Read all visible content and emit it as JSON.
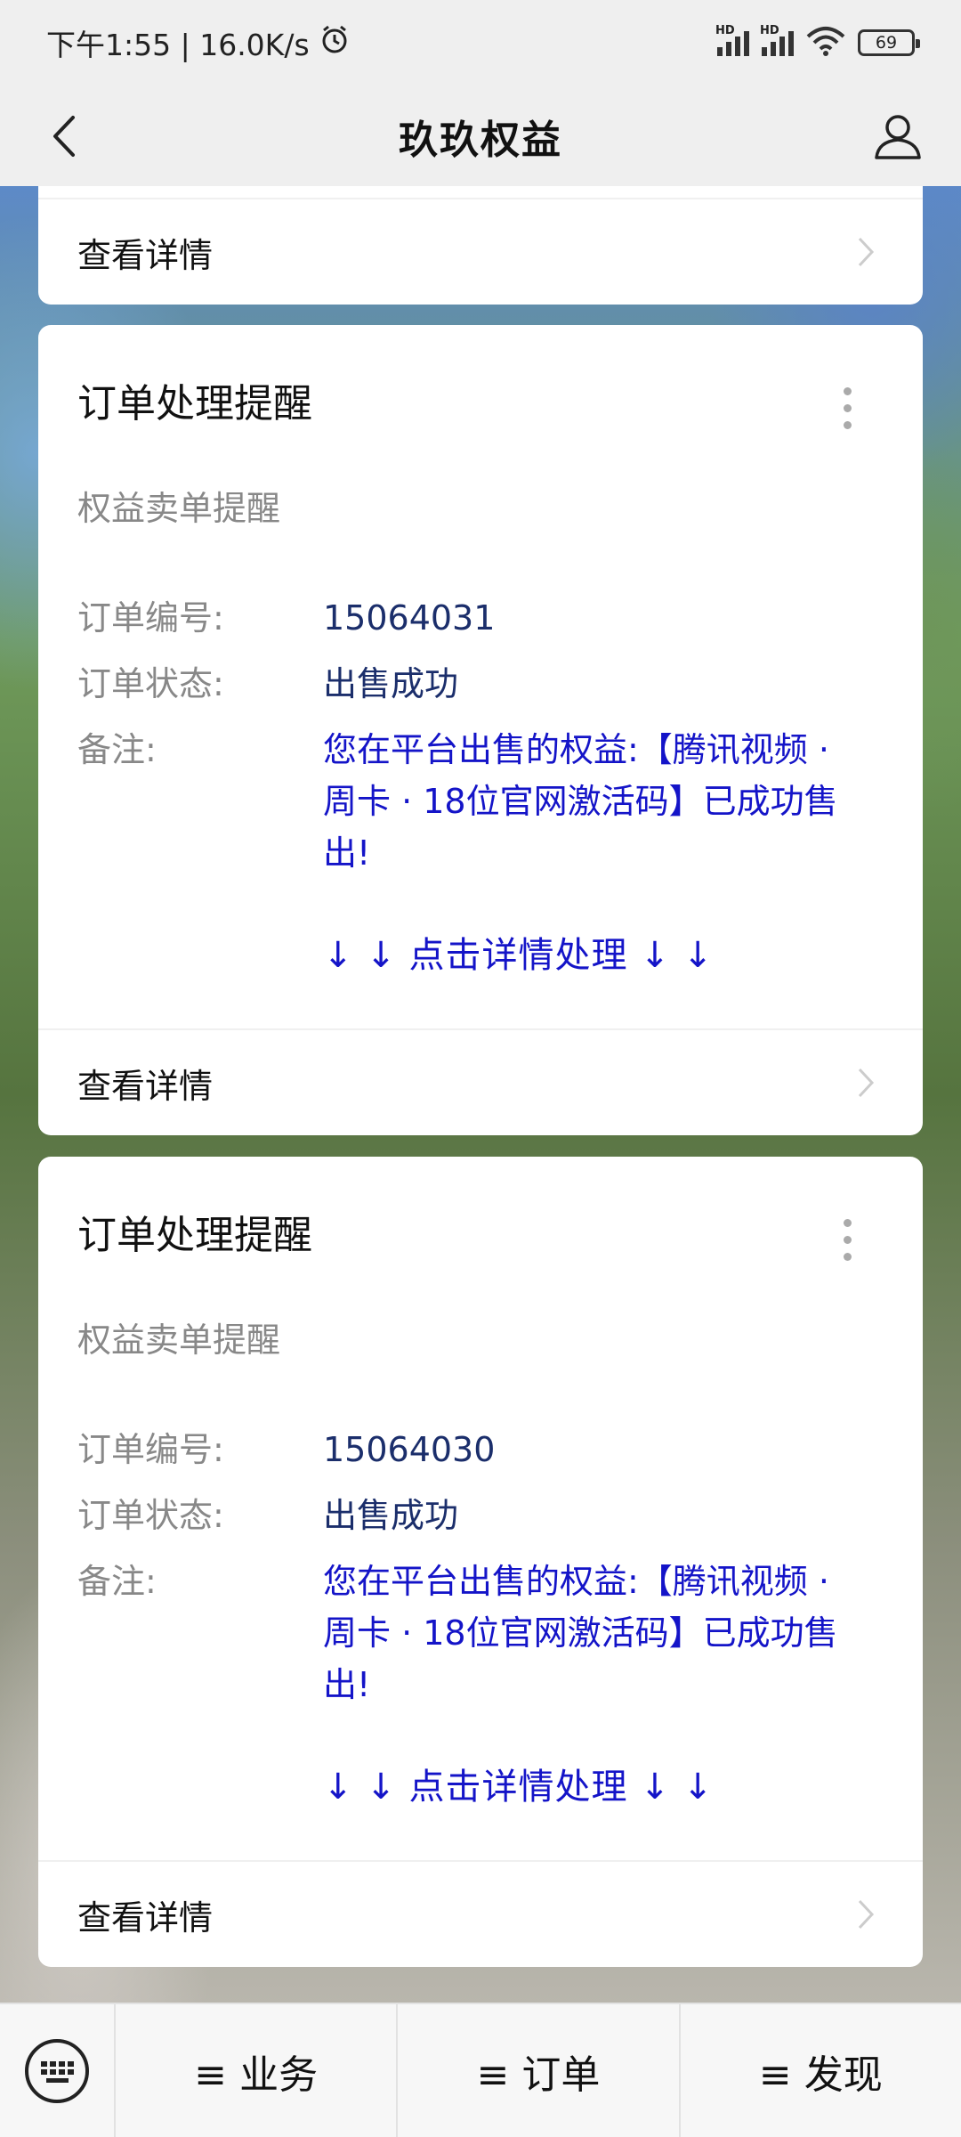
{
  "status_bar": {
    "time_speed": "下午1:55 | 16.0K/s",
    "network1": "HD",
    "network2": "HD",
    "battery": "69"
  },
  "nav": {
    "title": "玖玖权益",
    "back_icon": "chevron-left-icon",
    "user_icon": "user-icon"
  },
  "cards": [
    {
      "detail_label": "查看详情"
    },
    {
      "title": "订单处理提醒",
      "subtitle": "权益卖单提醒",
      "order_no_label": "订单编号:",
      "order_no": "15064031",
      "status_label": "订单状态:",
      "status": "出售成功",
      "note_label": "备注:",
      "note": "您在平台出售的权益:【腾讯视频 · 周卡 · 18位官网激活码】已成功售出!",
      "cta": "↓ ↓ 点击详情处理 ↓ ↓",
      "detail_label": "查看详情"
    },
    {
      "title": "订单处理提醒",
      "subtitle": "权益卖单提醒",
      "order_no_label": "订单编号:",
      "order_no": "15064030",
      "status_label": "订单状态:",
      "status": "出售成功",
      "note_label": "备注:",
      "note": "您在平台出售的权益:【腾讯视频 · 周卡 · 18位官网激活码】已成功售出!",
      "cta": "↓ ↓ 点击详情处理 ↓ ↓",
      "detail_label": "查看详情"
    }
  ],
  "bottom_menu": {
    "keyboard_icon": "keyboard-icon",
    "items": [
      "≡ 业务",
      "≡ 订单",
      "≡ 发现"
    ]
  },
  "colors": {
    "link_blue": "#1414c8",
    "value_navy": "#1b2e6b",
    "label_gray": "#888888"
  }
}
